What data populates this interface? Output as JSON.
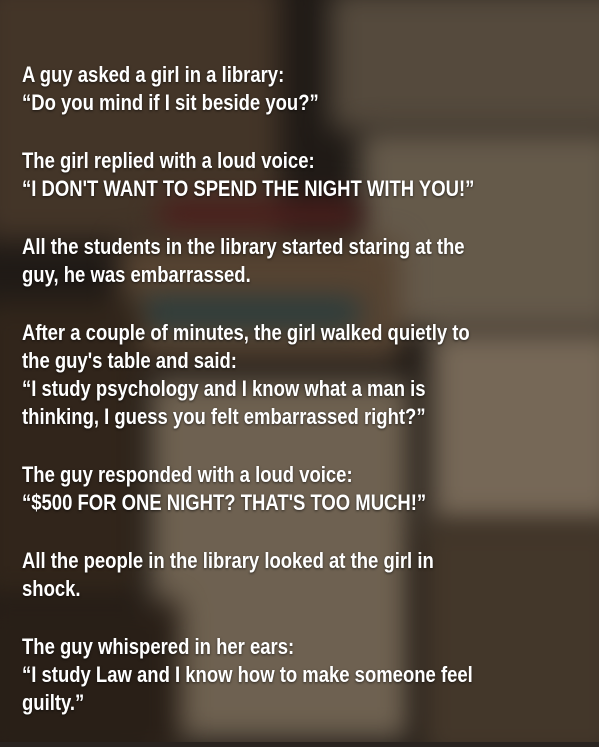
{
  "story": {
    "paragraphs": [
      [
        "A guy asked a girl in a library:",
        "“Do you mind if I sit beside you?”"
      ],
      [
        "The girl replied with a loud voice:",
        "“I DON'T WANT TO SPEND THE NIGHT WITH YOU!”"
      ],
      [
        "All the students in the library started staring at the",
        "guy, he was embarrassed."
      ],
      [
        "After a couple of minutes, the girl walked quietly to",
        "the guy's table and said:",
        "“I study psychology and I know what a man is",
        "thinking, I guess you felt embarrassed right?”"
      ],
      [
        "The guy responded with a loud voice:",
        "“$500 FOR ONE NIGHT? THAT'S TOO MUCH!”"
      ],
      [
        "All the people in the library looked at the girl in",
        "shock."
      ],
      [
        "The guy whispered in her ears:",
        "“I study Law and I know how to make someone feel",
        "guilty.”"
      ]
    ]
  }
}
